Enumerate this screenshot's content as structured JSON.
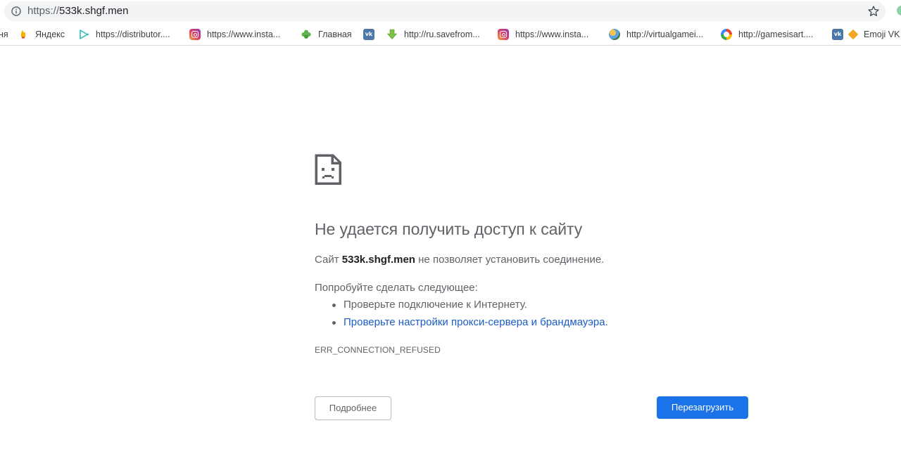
{
  "address_bar": {
    "url_scheme": "https://",
    "url_host": "533k.shgf.men"
  },
  "bookmarks": [
    {
      "label": "ня",
      "icon": "none"
    },
    {
      "label": "Яндекс",
      "icon": "hand-icon"
    },
    {
      "label": "https://distributor....",
      "icon": "play-icon"
    },
    {
      "label": "https://www.insta...",
      "icon": "instagram-icon"
    },
    {
      "label": "Главная",
      "icon": "clover-icon"
    },
    {
      "label": "",
      "icon": "vk-icon"
    },
    {
      "label": "http://ru.savefrom...",
      "icon": "download-arrow-icon"
    },
    {
      "label": "https://www.insta...",
      "icon": "instagram-icon"
    },
    {
      "label": "http://virtualgamei...",
      "icon": "globe-icon"
    },
    {
      "label": "http://gamesisart....",
      "icon": "gamesisart-icon"
    },
    {
      "label": "",
      "icon": "vk-icon"
    },
    {
      "label": "Emoji VK",
      "icon": "diamond-icon"
    }
  ],
  "error": {
    "title": "Не удается получить доступ к сайту",
    "site_prefix": "Сайт ",
    "site_host": "533k.shgf.men",
    "site_suffix": " не позволяет установить соединение.",
    "suggest_heading": "Попробуйте сделать следующее:",
    "suggestions": [
      "Проверьте подключение к Интернету.",
      "Проверьте настройки прокси-сервера и брандмауэра."
    ],
    "code": "ERR_CONNECTION_REFUSED"
  },
  "buttons": {
    "details": "Подробнее",
    "reload": "Перезагрузить"
  },
  "colors": {
    "link": "#1a5dc8",
    "primary_button": "#1a73e8",
    "vk": "#4a76a8"
  }
}
